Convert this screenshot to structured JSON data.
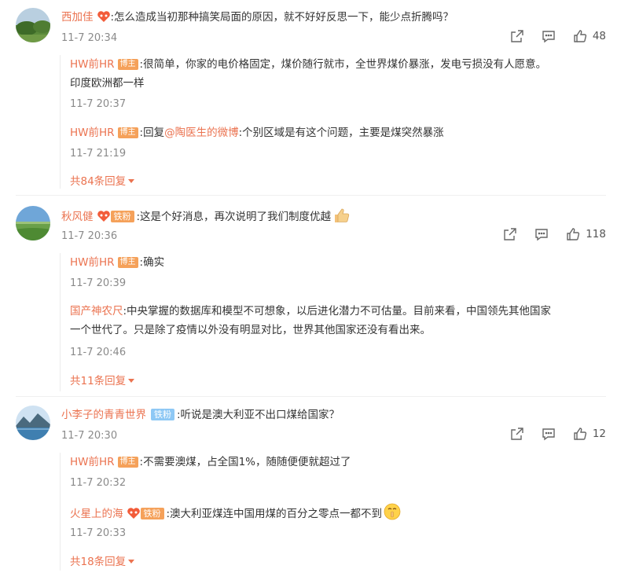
{
  "comments": [
    {
      "user": "西加佳",
      "text": ":怎么造成当初那种搞笑局面的原因，就不好好反思一下，能少点折腾吗？",
      "time": "11-7 20:34",
      "likes": "48",
      "replies": [
        {
          "user": "HW前HR",
          "badge": "博主",
          "text": ":很简单，你家的电价格固定，煤价随行就市，全世界煤价暴涨，发电亏损没有人愿意。",
          "text2": "印度欧洲都一样",
          "time": "11-7 20:37"
        },
        {
          "user": "HW前HR",
          "badge": "博主",
          "prefix": ":回复",
          "mention": "@陶医生的微博",
          "text": ":个别区域是有这个问题，主要是煤突然暴涨",
          "time": "11-7 21:19"
        }
      ],
      "more": "共84条回复"
    },
    {
      "user": "秋风健",
      "fan_badge": "铁粉",
      "text": ":这是个好消息，再次说明了我们制度优越",
      "emoji": "thumbs-up-emoji",
      "time": "11-7 20:36",
      "likes": "118",
      "replies": [
        {
          "user": "HW前HR",
          "badge": "博主",
          "text": ":确实",
          "time": "11-7 20:39"
        },
        {
          "user": "国产神农尺",
          "text": ":中央掌握的数据库和模型不可想象，以后进化潜力不可估量。目前来看，中国领先其他国家",
          "text2": "一个世代了。只是除了疫情以外没有明显对比，世界其他国家还没有看出来。",
          "time": "11-7 20:46"
        }
      ],
      "more": "共11条回复"
    },
    {
      "user": "小李子的青青世界",
      "fan_badge": "铁粉",
      "text": ":听说是澳大利亚不出口煤给国家？",
      "time": "11-7 20:30",
      "likes": "12",
      "replies": [
        {
          "user": "HW前HR",
          "badge": "博主",
          "text": ":不需要澳煤，占全国1%，随随便便就超过了",
          "time": "11-7 20:32"
        },
        {
          "user": "火星上的海",
          "fan_badge": "铁粉",
          "text": ":澳大利亚煤连中国用煤的百分之零点一都不到",
          "emoji": "shush-emoji",
          "time": "11-7 20:33"
        }
      ],
      "more": "共18条回复"
    }
  ],
  "colors": {
    "username": "#eb7350",
    "badge_blogger": "#f5a15a",
    "badge_fan": "#8ec8f5",
    "time": "#8a8a8a"
  }
}
